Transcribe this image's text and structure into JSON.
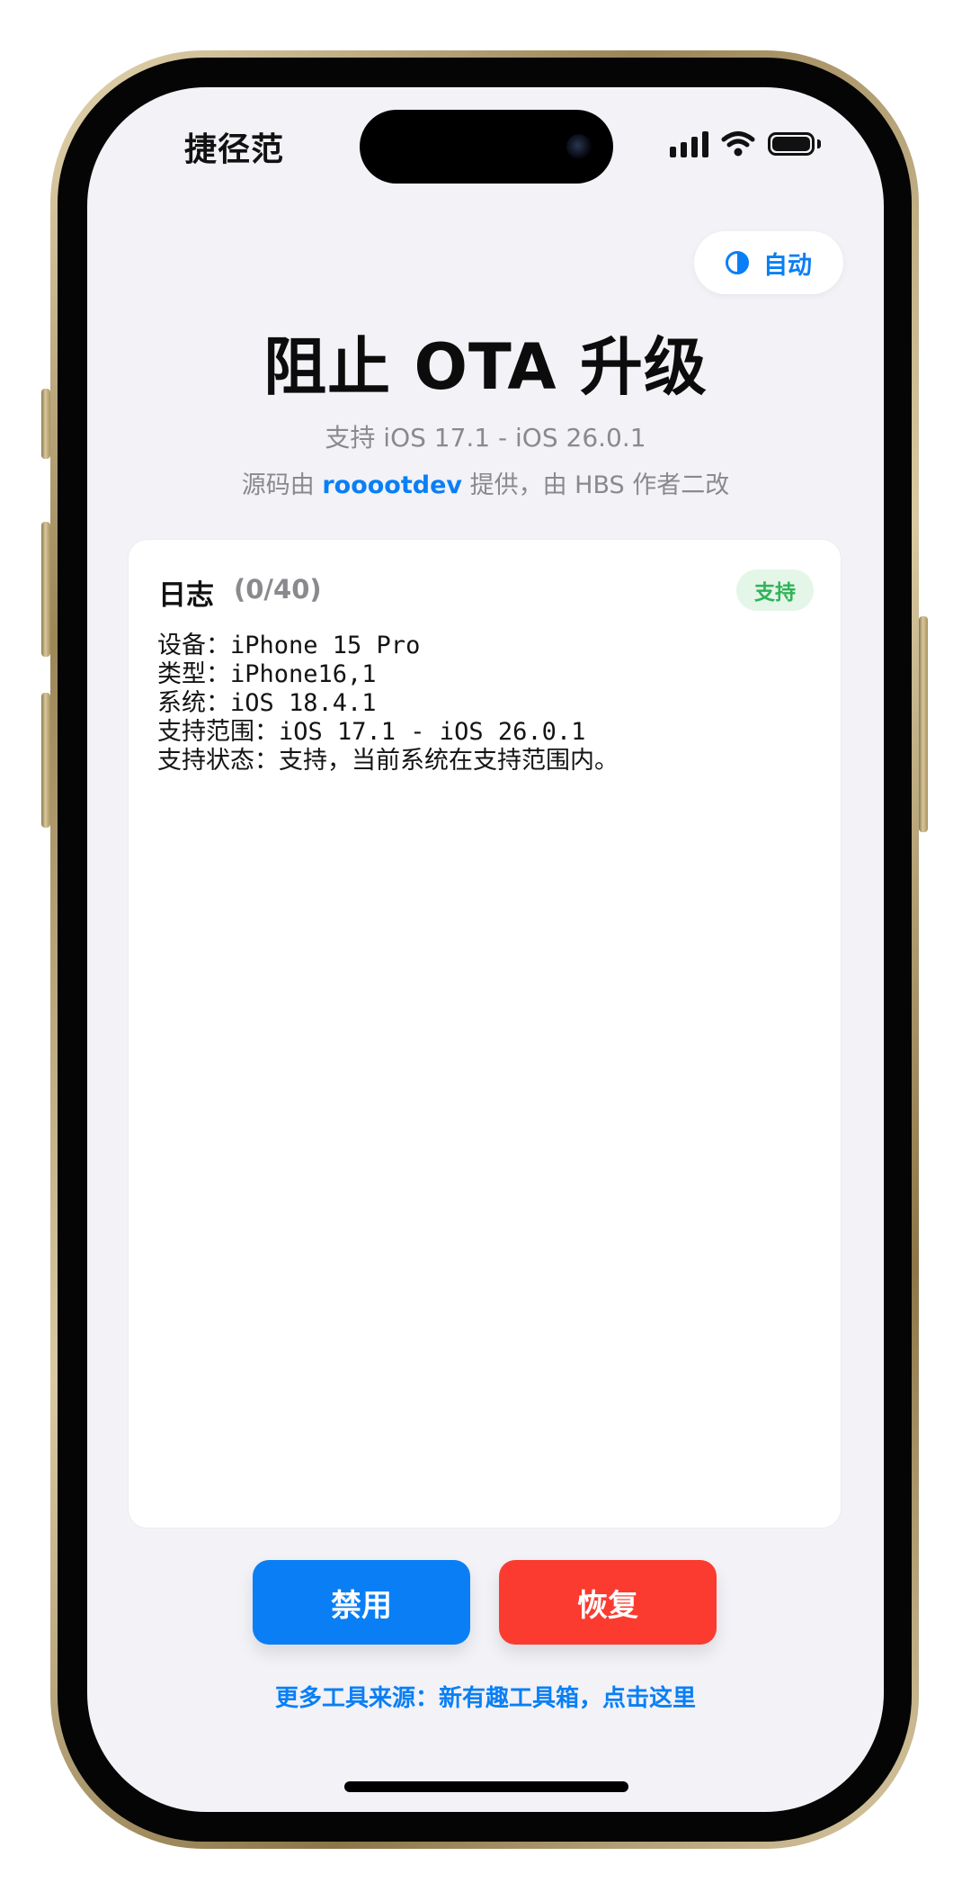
{
  "status_bar": {
    "carrier": "捷径范"
  },
  "header": {
    "theme_toggle_label": "自动",
    "title": "阻止 OTA 升级",
    "subtitle": "支持 iOS 17.1 - iOS 26.0.1",
    "credit_prefix": "源码由",
    "credit_author": "rooootdev",
    "credit_suffix": "提供，由 HBS 作者二改"
  },
  "log": {
    "title": "日志",
    "count": "(0/40)",
    "badge": "支持",
    "lines": [
      "设备：iPhone 15 Pro",
      "类型：iPhone16,1",
      "系统：iOS 18.4.1",
      "支持范围：iOS 17.1 - iOS 26.0.1",
      "支持状态：支持，当前系统在支持范围内。"
    ]
  },
  "actions": {
    "disable_label": "禁用",
    "restore_label": "恢复"
  },
  "footer": {
    "link_text": "更多工具来源：新有趣工具箱，点击这里"
  },
  "colors": {
    "accent": "#0a7ff5",
    "danger": "#fb3b30",
    "success": "#2fb457",
    "background": "#f2f2f7"
  },
  "icons": {
    "theme": "half-circle-contrast-icon",
    "signal": "cellular-signal-icon",
    "wifi": "wifi-icon",
    "battery": "battery-icon"
  }
}
